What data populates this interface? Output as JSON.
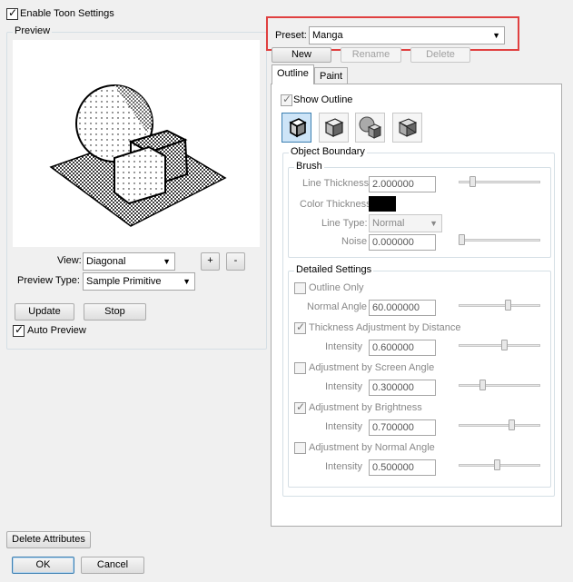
{
  "enable_toon": {
    "label": "Enable Toon Settings",
    "checked": true
  },
  "preview": {
    "title": "Preview",
    "view_label": "View:",
    "view_value": "Diagonal",
    "preview_type_label": "Preview Type:",
    "preview_type_value": "Sample Primitive",
    "zoom_in": "+",
    "zoom_out": "-",
    "update_label": "Update",
    "stop_label": "Stop",
    "auto_preview_label": "Auto Preview",
    "auto_preview_checked": true
  },
  "preset": {
    "label": "Preset:",
    "value": "Manga",
    "highlight_color": "#e04040",
    "new_label": "New",
    "rename_label": "Rename",
    "delete_label": "Delete"
  },
  "tabs": [
    {
      "label": "Outline",
      "active": true
    },
    {
      "label": "Paint",
      "active": false
    }
  ],
  "outline": {
    "show_outline_label": "Show Outline",
    "show_outline_checked": true,
    "style_icons": [
      "cube-outline-icon",
      "cube-shaded-icon",
      "sphere-cube-icon",
      "cube-wire-icon"
    ],
    "object_boundary": {
      "title": "Object Boundary",
      "brush": {
        "title": "Brush",
        "line_thickness_label": "Line Thickness",
        "line_thickness_value": "2.000000",
        "line_thickness_slider": 0.15,
        "color_thickness_label": "Color Thickness",
        "color_swatch": "#000000",
        "line_type_label": "Line Type:",
        "line_type_value": "Normal",
        "noise_label": "Noise",
        "noise_value": "0.000000",
        "noise_slider": 0.0
      },
      "detailed": {
        "title": "Detailed Settings",
        "outline_only": {
          "label": "Outline Only",
          "checked": false
        },
        "normal_angle": {
          "label": "Normal Angle",
          "value": "60.000000",
          "slider": 0.62
        },
        "thickness_distance": {
          "label": "Thickness Adjustment by Distance",
          "checked": true
        },
        "intensity1": {
          "label": "Intensity",
          "value": "0.600000",
          "slider": 0.57
        },
        "screen_angle": {
          "label": "Adjustment by Screen Angle",
          "checked": false
        },
        "intensity2": {
          "label": "Intensity",
          "value": "0.300000",
          "slider": 0.28
        },
        "brightness": {
          "label": "Adjustment by Brightness",
          "checked": true
        },
        "intensity3": {
          "label": "Intensity",
          "value": "0.700000",
          "slider": 0.66
        },
        "normal_angle_adj": {
          "label": "Adjustment by Normal Angle",
          "checked": false
        },
        "intensity4": {
          "label": "Intensity",
          "value": "0.500000",
          "slider": 0.47
        }
      }
    }
  },
  "footer": {
    "delete_attributes_label": "Delete Attributes",
    "ok_label": "OK",
    "cancel_label": "Cancel"
  }
}
